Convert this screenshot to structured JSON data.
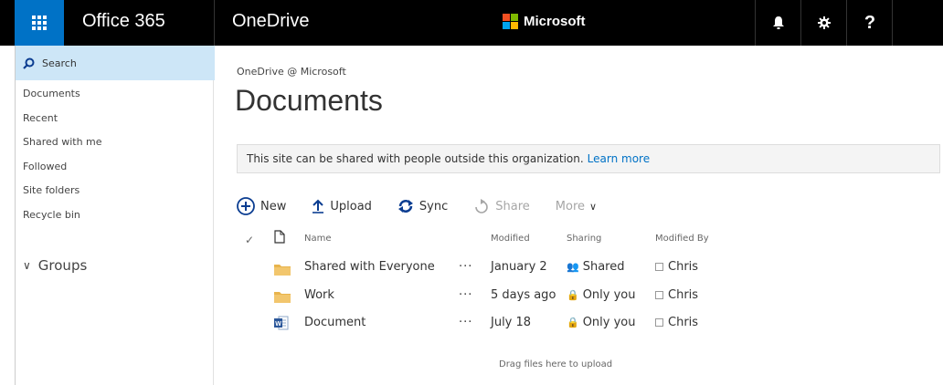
{
  "topbar": {
    "brand": "Office 365",
    "app_name": "OneDrive",
    "microsoft": "Microsoft",
    "icons": [
      "app-launcher-icon",
      "bell-icon",
      "gear-icon",
      "help-icon"
    ]
  },
  "nav": {
    "search_label": "Search",
    "items": [
      "Documents",
      "Recent",
      "Shared with me",
      "Followed",
      "Site folders",
      "Recycle bin"
    ],
    "groups_label": "Groups"
  },
  "main": {
    "breadcrumb": "OneDrive @ Microsoft",
    "title": "Documents",
    "banner_text": "This site can be shared with people outside this organization.",
    "banner_link": "Learn more",
    "commands": {
      "new": "New",
      "upload": "Upload",
      "sync": "Sync",
      "share": "Share",
      "more": "More"
    },
    "columns": {
      "name": "Name",
      "modified": "Modified",
      "sharing": "Sharing",
      "modified_by": "Modified By"
    },
    "rows": [
      {
        "name": "Shared with Everyone",
        "type": "folder",
        "modified": "January 2",
        "sharing": "Shared",
        "sharing_icon": "people-icon",
        "modified_by": "Chris"
      },
      {
        "name": "Work",
        "type": "folder",
        "modified": "5 days ago",
        "sharing": "Only you",
        "sharing_icon": "lock-icon",
        "modified_by": "Chris"
      },
      {
        "name": "Document",
        "type": "word-document",
        "modified": "July 18",
        "sharing": "Only you",
        "sharing_icon": "lock-icon",
        "modified_by": "Chris"
      }
    ],
    "row_menu": "···",
    "drag_hint": "Drag files here to upload"
  },
  "colors": {
    "topbar": "#000000",
    "launcher": "#0072c6",
    "search_bg": "#cde6f7",
    "accent": "#0072c6",
    "folder": "#e8b44c"
  }
}
